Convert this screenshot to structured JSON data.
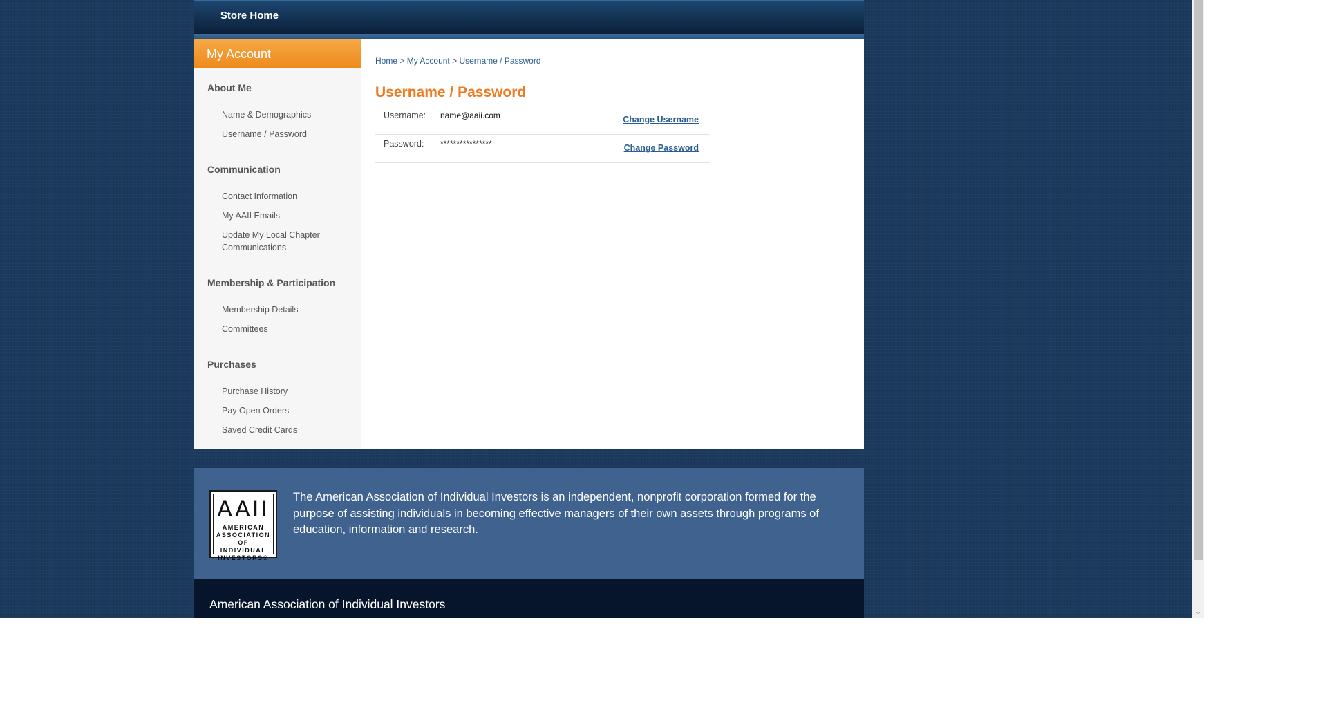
{
  "nav": {
    "store_home": "Store Home"
  },
  "sidebar": {
    "header": "My Account",
    "sections": [
      {
        "title": "About Me",
        "links": [
          "Name & Demographics",
          "Username / Password"
        ]
      },
      {
        "title": "Communication",
        "links": [
          "Contact Information",
          "My AAII Emails",
          "Update My Local Chapter Communications"
        ]
      },
      {
        "title": "Membership & Participation",
        "links": [
          "Membership Details",
          "Committees"
        ]
      },
      {
        "title": "Purchases",
        "links": [
          "Purchase History",
          "Pay Open Orders",
          "Saved Credit Cards"
        ]
      }
    ]
  },
  "breadcrumb": {
    "home": "Home",
    "sep": ">",
    "my_account": "My Account",
    "current": "Username / Password"
  },
  "content": {
    "title": "Username / Password",
    "rows": [
      {
        "label": "Username:",
        "value": "name@aaii.com",
        "action": "Change Username"
      },
      {
        "label": "Password:",
        "value": "****************",
        "action": "Change Password"
      }
    ]
  },
  "footer": {
    "logo_mark": "AAII",
    "logo_text": [
      "AMERICAN",
      "ASSOCIATION OF",
      "INDIVIDUAL",
      "INVESTORS®"
    ],
    "description": "The American Association of Individual Investors is an independent, nonprofit corporation formed for the purpose of assisting individuals in becoming effective managers of their own assets through programs of education, information and research.",
    "org_name": "American Association of Individual Investors"
  }
}
